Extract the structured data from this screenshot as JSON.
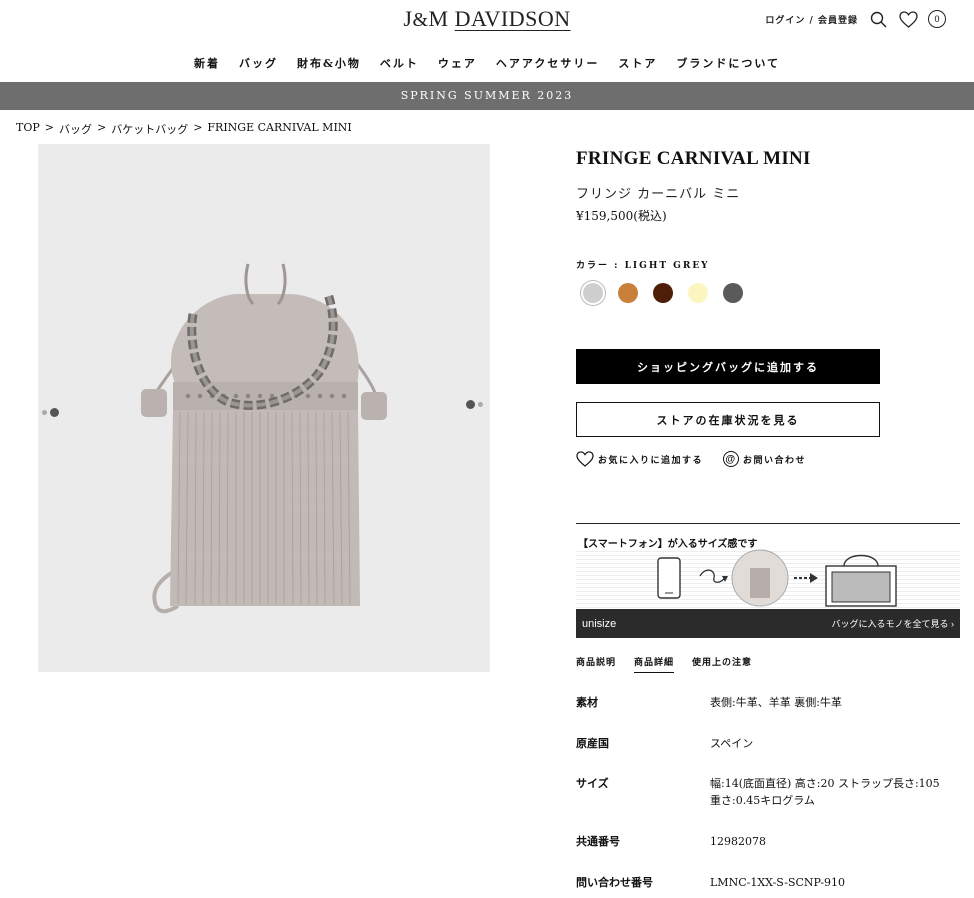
{
  "header": {
    "logo_left": "J",
    "logo_amp": "&",
    "logo_m": "M ",
    "logo_right": "DAVIDSON",
    "login": "ログイン",
    "slash": " / ",
    "register": "会員登録",
    "cart_count": "0"
  },
  "nav": [
    "新着",
    "バッグ",
    "財布&小物",
    "ベルト",
    "ウェア",
    "ヘアアクセサリー",
    "ストア",
    "ブランドについて"
  ],
  "banner": "SPRING SUMMER 2023",
  "breadcrumb": {
    "items": [
      "TOP",
      "バッグ",
      "バケットバッグ",
      "FRINGE CARNIVAL MINI"
    ],
    "sep": ">"
  },
  "product": {
    "title": "FRINGE CARNIVAL MINI",
    "jp_name": "フリンジ カーニバル ミニ",
    "price": "¥159,500(税込)",
    "color_label": "カラー : LIGHT GREY",
    "swatches": [
      {
        "color": "#cfcfcf",
        "name": "light-grey"
      },
      {
        "color": "#c8803b",
        "name": "tan"
      },
      {
        "color": "#4e1f08",
        "name": "dark-brown"
      },
      {
        "color": "#fbf5bf",
        "name": "cream"
      },
      {
        "color": "#5a5a5a",
        "name": "dark-grey"
      }
    ],
    "add_to_bag": "ショッピングバッグに追加する",
    "store_stock": "ストアの在庫状況を見る",
    "favorite": "お気に入りに追加する",
    "contact": "お問い合わせ",
    "contact_mark": "@"
  },
  "unisize": {
    "heading": "【スマートフォン】が入るサイズ感です",
    "brand": "unisize",
    "more": "バッグに入るモノを全て見る ›"
  },
  "tabs": [
    "商品説明",
    "商品詳細",
    "使用上の注意"
  ],
  "specs": [
    {
      "label": "素材",
      "value": "表側:牛革、羊革 裏側:牛革"
    },
    {
      "label": "原産国",
      "value": "スペイン"
    },
    {
      "label": "サイズ",
      "value": "幅:14(底面直径) 高さ:20 ストラップ長さ:105 重さ:0.45キログラム"
    },
    {
      "label": "共通番号",
      "value": "12982078"
    },
    {
      "label": "問い合わせ番号",
      "value": "LMNC-1XX-S-SCNP-910"
    }
  ]
}
